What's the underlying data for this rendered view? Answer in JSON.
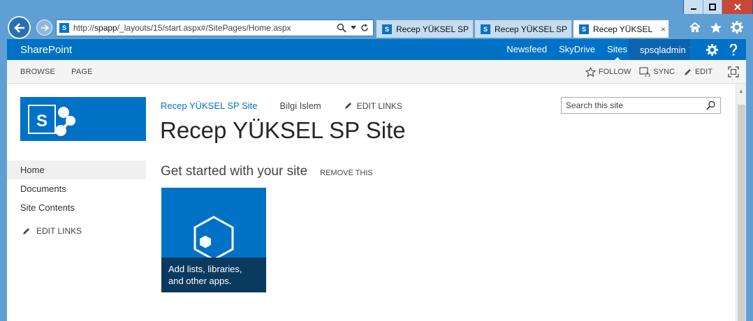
{
  "browser": {
    "address": {
      "prefix": "http://",
      "host": "spapp",
      "path": "/_layouts/15/start.aspx#/SitePages/Home.aspx"
    },
    "tabs": [
      {
        "label": "Recep YÜKSEL SP Si..."
      },
      {
        "label": "Recep YÜKSEL SP Si..."
      },
      {
        "label": "Recep YÜKSEL S...",
        "close": "×"
      }
    ]
  },
  "suitebar": {
    "brand": "SharePoint",
    "links": [
      "Newsfeed",
      "SkyDrive",
      "Sites"
    ],
    "user": "spsqladmin"
  },
  "ribbon": {
    "tabs": [
      "BROWSE",
      "PAGE"
    ],
    "actions": {
      "follow": "FOLLOW",
      "sync": "SYNC",
      "edit": "EDIT"
    }
  },
  "site": {
    "topnav": {
      "site_link": "Recep YÜKSEL SP Site",
      "item": "Bilgi Islem",
      "edit_links": "EDIT LINKS"
    },
    "title": "Recep YÜKSEL SP Site",
    "search_placeholder": "Search this site"
  },
  "quicklaunch": {
    "items": [
      "Home",
      "Documents",
      "Site Contents"
    ],
    "edit_links": "EDIT LINKS"
  },
  "getstarted": {
    "title": "Get started with your site",
    "remove": "REMOVE THIS",
    "tile_caption": "Add lists, libraries, and other apps."
  },
  "colors": {
    "suite_blue": "#0072c6",
    "tile_caption_bg": "#0b3a5f",
    "chrome_blue": "#5f9fd3"
  },
  "icons": [
    "back-arrow-icon",
    "forward-arrow-icon",
    "search-icon",
    "refresh-icon",
    "home-icon",
    "star-icon",
    "gear-icon",
    "help-icon",
    "pencil-icon",
    "sync-icon",
    "focus-icon"
  ]
}
